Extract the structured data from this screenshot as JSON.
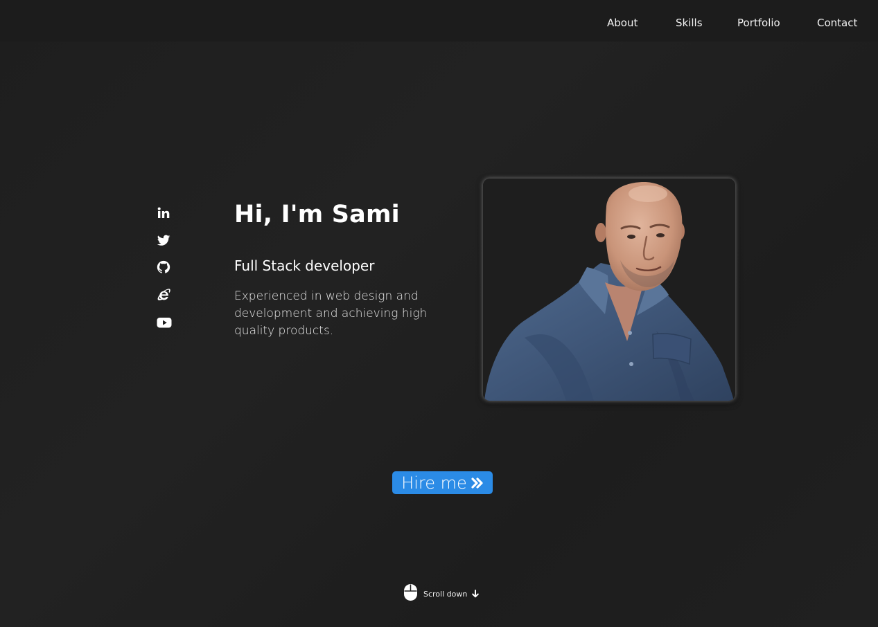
{
  "nav": {
    "items": [
      {
        "label": "About"
      },
      {
        "label": "Skills"
      },
      {
        "label": "Portfolio"
      },
      {
        "label": "Contact"
      }
    ]
  },
  "social": {
    "icons": [
      "linkedin-icon",
      "twitter-icon",
      "github-icon",
      "internet-explorer-icon",
      "youtube-icon"
    ]
  },
  "intro": {
    "greeting": "Hi, I'm Sami",
    "role": "Full Stack developer",
    "description": "Experienced in web design and development and achieving high quality products."
  },
  "hire_button": {
    "label": "Hire me",
    "icon": "double-chevron-right-icon",
    "color": "#2b8be6"
  },
  "scroll": {
    "label": "Scroll down",
    "icons": [
      "mouse-icon",
      "arrow-down-icon"
    ]
  },
  "colors": {
    "background": "#1f1f1f",
    "text": "#ffffff",
    "accent": "#2b8be6"
  }
}
